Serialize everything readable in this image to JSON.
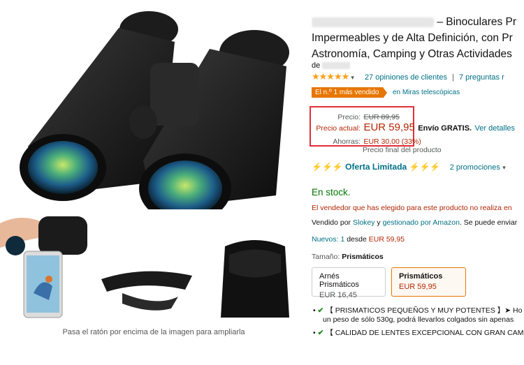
{
  "product": {
    "title_line1": "– Binoculares Pr",
    "title_line2": "Impermeables y de Alta Definición, con Pr",
    "title_line3": "Astronomía, Camping y Otras Actividades",
    "brand_prefix": "de",
    "rating_stars": "★★★★★",
    "ratings_count": "27 opiniones de clientes",
    "questions": "7 preguntas r",
    "bestseller_badge": "El n.º 1 más vendido",
    "bestseller_category": "en Miras telescópicas"
  },
  "pricing": {
    "list_label": "Precio:",
    "list_price": "EUR 89,95",
    "current_label": "Precio actual:",
    "current_price": "EUR 59,95",
    "shipping": "Envío GRATIS.",
    "shipping_link": "Ver detalles",
    "savings_label": "Ahorras:",
    "savings_value": "EUR 30,00 (33%)",
    "final_note": "Precio final del producto"
  },
  "deal": {
    "label": "Oferta Limitada",
    "promotions": "2 promociones",
    "bolt": "⚡"
  },
  "availability": {
    "stock": "En stock.",
    "seller_warning": "El vendedor que has elegido para este producto no realiza en",
    "sold_by_prefix": "Vendido por",
    "seller": "Slokey",
    "and": "y",
    "fulfilled": "gestionado por Amazon",
    "sold_by_suffix": ". Se puede enviar",
    "new_prefix": "Nuevos:",
    "new_count": "1",
    "new_from": "desde",
    "new_price": "EUR 59,95"
  },
  "size": {
    "label": "Tamaño:",
    "selected": "Prismáticos",
    "options": [
      {
        "name": "Arnés Prismáticos",
        "price": "EUR 16,45"
      },
      {
        "name": "Prismáticos",
        "price": "EUR 59,95"
      }
    ]
  },
  "bullets": [
    "【 PRISMATICOS PEQUEÑOS Y MUY POTENTES 】➤ Ho",
    "un peso de sólo 530g, podrá llevarlos colgados sin apenas",
    "【 CALIDAD DE LENTES EXCEPCIONAL CON GRAN CAM"
  ],
  "image_hint": "Pasa el ratón por encima de la imagen para ampliarla",
  "colors": {
    "accent": "#e77600",
    "price_red": "#b12704",
    "link": "#007185",
    "stock_green": "#007600",
    "highlight_box": "#e0303a"
  }
}
